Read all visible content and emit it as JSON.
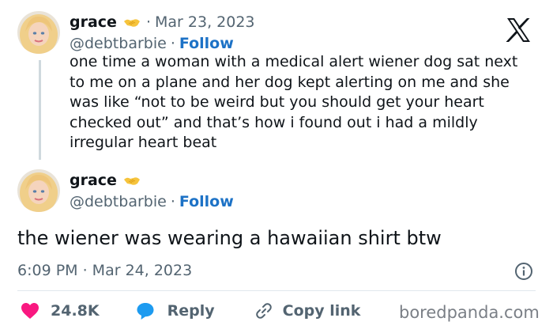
{
  "reply_tweet": {
    "name": "grace",
    "separator": "·",
    "date": "Mar 23, 2023",
    "handle": "@debtbarbie",
    "dot": "·",
    "follow_label": "Follow",
    "text": "one time a woman with a medical alert wiener dog sat next to me on a plane and her dog kept alerting on me and she was like “not to be weird but you should get your heart checked out” and that’s how i found out i had a mildly irregular heart beat"
  },
  "main_tweet": {
    "name": "grace",
    "handle": "@debtbarbie",
    "dot": "·",
    "follow_label": "Follow",
    "text": "the wiener was wearing a hawaiian shirt btw",
    "timestamp": "6:09 PM · Mar 24, 2023"
  },
  "actions": {
    "likes_count": "24.8K",
    "reply_label": "Reply",
    "copy_link_label": "Copy link"
  },
  "watermark": "boredpanda.com",
  "icons": {
    "brand": "x-logo-icon",
    "badge": "handshake-emoji-icon",
    "like": "heart-icon",
    "reply": "speech-bubble-icon",
    "copy": "link-icon",
    "info": "info-icon"
  },
  "colors": {
    "like": "#f91880",
    "reply_icon": "#1d9bf0",
    "follow": "#1d72c6",
    "muted_text": "#536471"
  }
}
